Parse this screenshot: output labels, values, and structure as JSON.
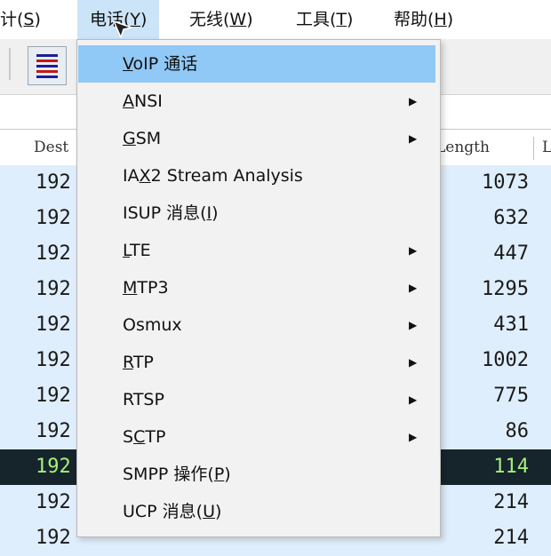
{
  "menubar": {
    "items": [
      {
        "prefix": "计(",
        "mnemonic": "S",
        "suffix": ")"
      },
      {
        "prefix": "电话(",
        "mnemonic": "Y",
        "suffix": ")"
      },
      {
        "prefix": "无线(",
        "mnemonic": "W",
        "suffix": ")"
      },
      {
        "prefix": "工具(",
        "mnemonic": "T",
        "suffix": ")"
      },
      {
        "prefix": "帮助(",
        "mnemonic": "H",
        "suffix": ")"
      }
    ]
  },
  "toolbar": {
    "button_icon": "colorize-lines-icon",
    "line_colors": [
      "#1c1c9c",
      "#c01818",
      "#1c1c9c",
      "#c01818",
      "#1c1c9c"
    ]
  },
  "packet_list": {
    "columns": {
      "dest": "Dest",
      "length": "Length",
      "extra": "L"
    },
    "rows": [
      {
        "dest": "192",
        "length": "1073"
      },
      {
        "dest": "192",
        "length": "632"
      },
      {
        "dest": "192",
        "length": "447"
      },
      {
        "dest": "192",
        "length": "1295"
      },
      {
        "dest": "192",
        "length": "431"
      },
      {
        "dest": "192",
        "length": "1002"
      },
      {
        "dest": "192",
        "length": "775"
      },
      {
        "dest": "192",
        "length": "86"
      },
      {
        "dest": "192",
        "length": "114",
        "selected": true
      },
      {
        "dest": "192",
        "length": "214"
      },
      {
        "dest": "192",
        "length": "214"
      }
    ]
  },
  "telephony_menu": {
    "items": [
      {
        "pre": "",
        "mn": "V",
        "post": "oIP 通话",
        "submenu": false,
        "highlighted": true
      },
      {
        "pre": "",
        "mn": "A",
        "post": "NSI",
        "submenu": true
      },
      {
        "pre": "",
        "mn": "G",
        "post": "SM",
        "submenu": true
      },
      {
        "pre": "IA",
        "mn": "X",
        "post": "2 Stream Analysis",
        "submenu": false
      },
      {
        "pre": "ISUP 消息(",
        "mn": "I",
        "post": ")",
        "submenu": false
      },
      {
        "pre": "",
        "mn": "L",
        "post": "TE",
        "submenu": true
      },
      {
        "pre": "",
        "mn": "M",
        "post": "TP3",
        "submenu": true
      },
      {
        "pre": "Osmux",
        "mn": "",
        "post": "",
        "submenu": true
      },
      {
        "pre": "",
        "mn": "R",
        "post": "TP",
        "submenu": true
      },
      {
        "pre": "RTSP",
        "mn": "",
        "post": "",
        "submenu": true
      },
      {
        "pre": "S",
        "mn": "C",
        "post": "TP",
        "submenu": true
      },
      {
        "pre": "SMPP 操作(",
        "mn": "P",
        "post": ")",
        "submenu": false
      },
      {
        "pre": "UCP 消息(",
        "mn": "U",
        "post": ")",
        "submenu": false
      }
    ],
    "submenu_icon": "submenu-arrow-icon"
  },
  "colors": {
    "menu_highlight": "#90c8f6",
    "row_bg": "#dfeefc",
    "selected_row_bg": "#16252c",
    "selected_row_text": "#a6f07a"
  }
}
